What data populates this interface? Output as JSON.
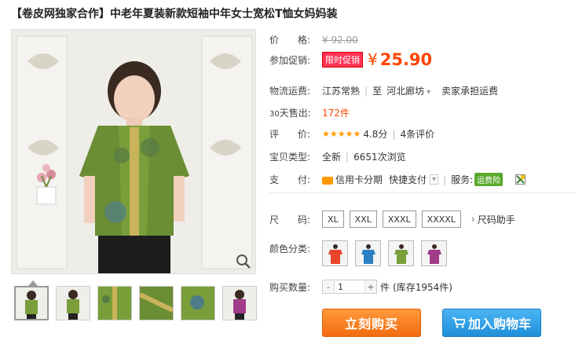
{
  "product": {
    "title": "【卷皮网独家合作】中老年夏装新款短袖中年女士宽松T恤女妈妈装"
  },
  "price": {
    "label": "价　　格:",
    "original": "¥ 92.00"
  },
  "promo": {
    "label": "参加促销:",
    "tag": "限时促销",
    "currency": "¥",
    "price": "25.90"
  },
  "shipping": {
    "label": "物流运费:",
    "from": "江苏常熟",
    "to_prefix": "至",
    "to": "河北廊坊",
    "fee": "卖家承担运费"
  },
  "sales": {
    "label_prefix": "30",
    "label": "天售出:",
    "count": "172件"
  },
  "rating": {
    "label": "评　　价:",
    "stars": "★★★★★",
    "score": "4.8分",
    "reviews": "4条评价"
  },
  "type": {
    "label": "宝贝类型:",
    "condition": "全新",
    "views": "6651次浏览"
  },
  "payment": {
    "label": "支　　付:",
    "credit": "信用卡分期",
    "quick": "快捷支付",
    "service_label": "服务:",
    "service_badge": "运费险"
  },
  "sizes": {
    "label": "尺　　码:",
    "options": [
      "XL",
      "XXL",
      "XXXL",
      "XXXXL"
    ],
    "helper": "尺码助手"
  },
  "colors": {
    "label": "颜色分类:",
    "options": [
      {
        "name": "红色",
        "hex": "#e8452c"
      },
      {
        "name": "蓝色",
        "hex": "#2c7fc2"
      },
      {
        "name": "绿色",
        "hex": "#7a9e3a"
      },
      {
        "name": "紫红",
        "hex": "#a23a8a"
      }
    ]
  },
  "quantity": {
    "label": "购买数量:",
    "minus": "-",
    "value": "1",
    "plus": "+",
    "unit": "件",
    "stock": "(库存1954件)"
  },
  "actions": {
    "buy": "立刻购买",
    "cart": "加入购物车"
  },
  "theme": {
    "accent": "#ff4400",
    "buy_button": "#f26b0f",
    "cart_button": "#1f8fd9",
    "shirt_green": "#7a9e3a"
  }
}
